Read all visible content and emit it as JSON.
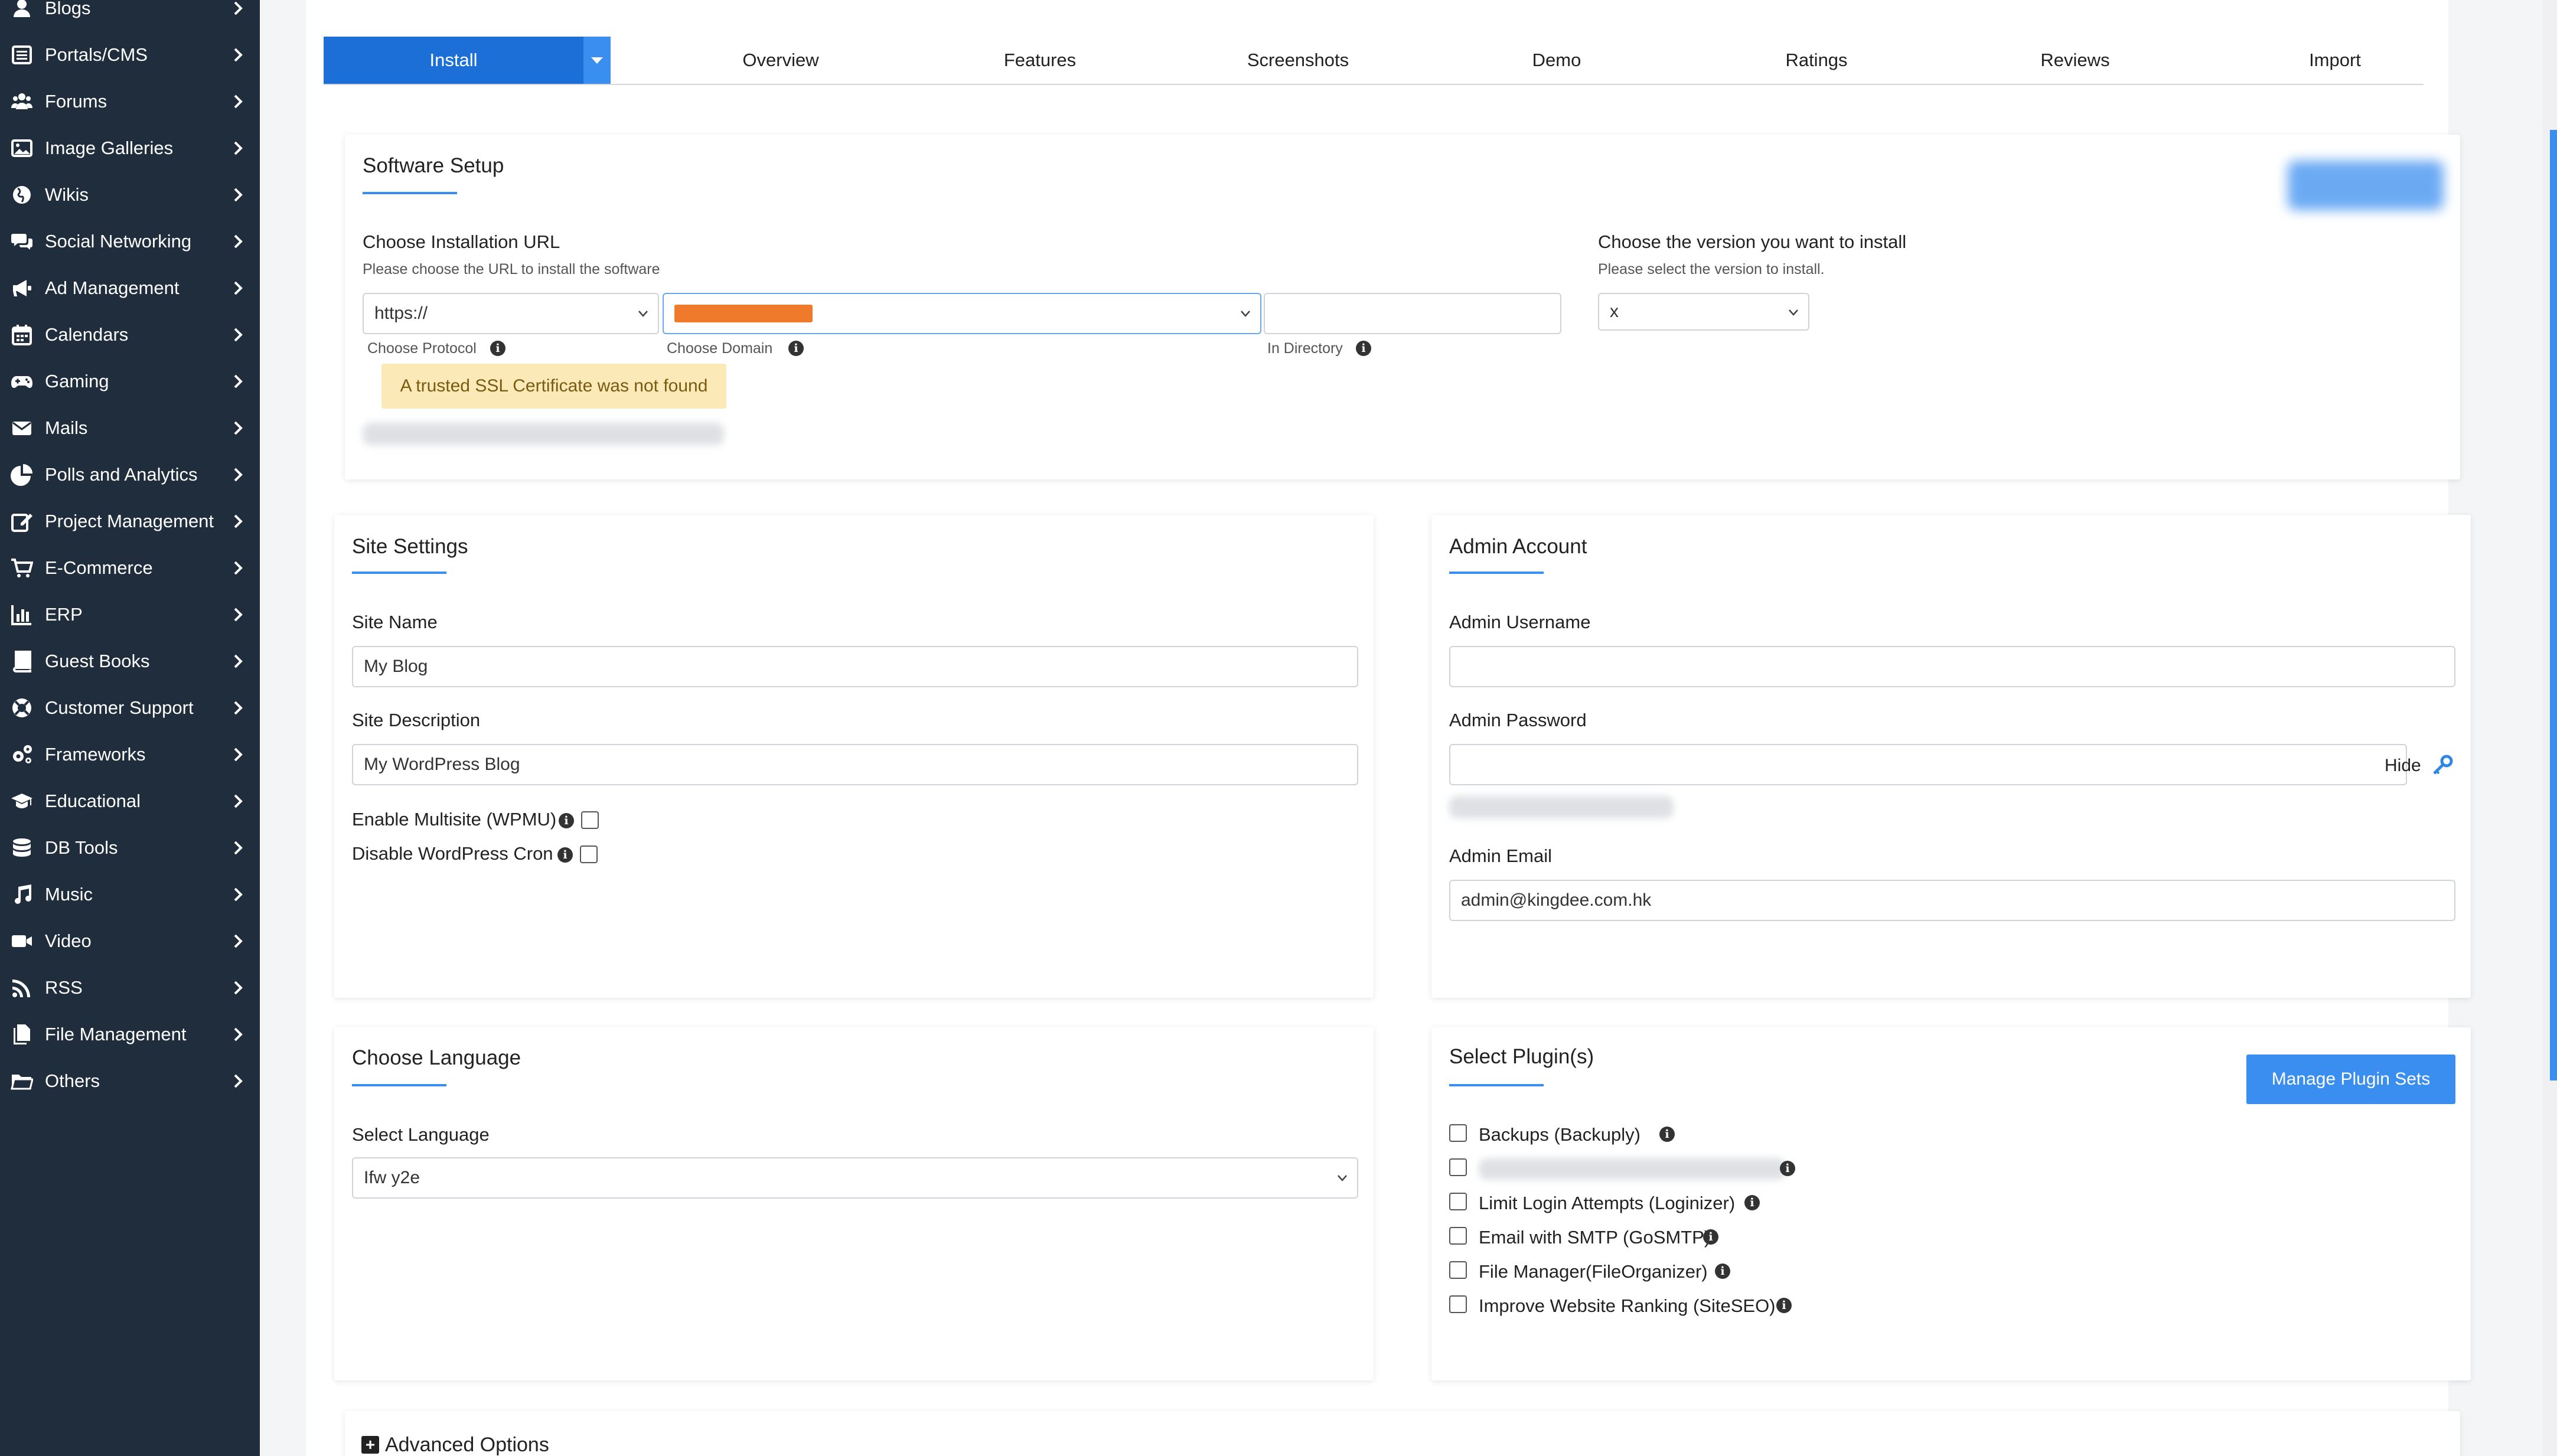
{
  "sidebar": {
    "items": [
      {
        "label": "Blogs",
        "icon": "user-icon"
      },
      {
        "label": "Portals/CMS",
        "icon": "list-icon"
      },
      {
        "label": "Forums",
        "icon": "users-icon"
      },
      {
        "label": "Image Galleries",
        "icon": "image-icon"
      },
      {
        "label": "Wikis",
        "icon": "globe-icon"
      },
      {
        "label": "Social Networking",
        "icon": "comments-icon"
      },
      {
        "label": "Ad Management",
        "icon": "megaphone-icon"
      },
      {
        "label": "Calendars",
        "icon": "calendar-icon"
      },
      {
        "label": "Gaming",
        "icon": "gamepad-icon"
      },
      {
        "label": "Mails",
        "icon": "envelope-icon"
      },
      {
        "label": "Polls and Analytics",
        "icon": "pie-chart-icon"
      },
      {
        "label": "Project Management",
        "icon": "edit-icon"
      },
      {
        "label": "E-Commerce",
        "icon": "cart-icon"
      },
      {
        "label": "ERP",
        "icon": "bar-chart-icon"
      },
      {
        "label": "Guest Books",
        "icon": "book-icon"
      },
      {
        "label": "Customer Support",
        "icon": "lifebuoy-icon"
      },
      {
        "label": "Frameworks",
        "icon": "gears-icon"
      },
      {
        "label": "Educational",
        "icon": "graduation-cap-icon"
      },
      {
        "label": "DB Tools",
        "icon": "database-icon"
      },
      {
        "label": "Music",
        "icon": "music-icon"
      },
      {
        "label": "Video",
        "icon": "video-icon"
      },
      {
        "label": "RSS",
        "icon": "rss-icon"
      },
      {
        "label": "File Management",
        "icon": "files-icon"
      },
      {
        "label": "Others",
        "icon": "folder-icon"
      }
    ]
  },
  "tabs": {
    "install": "Install",
    "items": [
      "Overview",
      "Features",
      "Screenshots",
      "Demo",
      "Ratings",
      "Reviews",
      "Import"
    ]
  },
  "software_setup": {
    "title": "Software Setup",
    "choose_url_label": "Choose Installation URL",
    "choose_url_help": "Please choose the URL to install the software",
    "protocol_value": "https://",
    "protocol_caption": "Choose Protocol",
    "domain_caption": "Choose Domain",
    "directory_value": "",
    "directory_caption": "In Directory",
    "ssl_warning": "A trusted SSL Certificate was not found",
    "version_label": "Choose the version you want to install",
    "version_help": "Please select the version to install.",
    "version_value": "x"
  },
  "site_settings": {
    "title": "Site Settings",
    "site_name_label": "Site Name",
    "site_name_value": "My Blog",
    "site_desc_label": "Site Description",
    "site_desc_value": "My WordPress Blog",
    "multisite_label": "Enable Multisite (WPMU)",
    "cron_label": "Disable WordPress Cron"
  },
  "admin_account": {
    "title": "Admin Account",
    "username_label": "Admin Username",
    "username_value": "",
    "password_label": "Admin Password",
    "password_value": "",
    "hide_label": "Hide",
    "email_label": "Admin Email",
    "email_value": "admin@kingdee.com.hk"
  },
  "choose_language": {
    "title": "Choose Language",
    "select_label": "Select Language",
    "select_value": "Ifw y2e"
  },
  "plugins": {
    "title": "Select Plugin(s)",
    "manage_button": "Manage Plugin Sets",
    "items": [
      "Backups (Backuply)",
      "",
      "Limit Login Attempts (Loginizer)",
      "Email with SMTP (GoSMTP)",
      "File Manager(FileOrganizer)",
      "Improve Website Ranking (SiteSEO)"
    ]
  },
  "advanced": {
    "label": "Advanced Options"
  },
  "colors": {
    "sidebar_bg": "#1f2d3d",
    "accent": "#1b6fd6",
    "accent_light": "#3a8ef0",
    "warning_bg": "#fbe9b7",
    "redaction": "#f07a2c"
  }
}
